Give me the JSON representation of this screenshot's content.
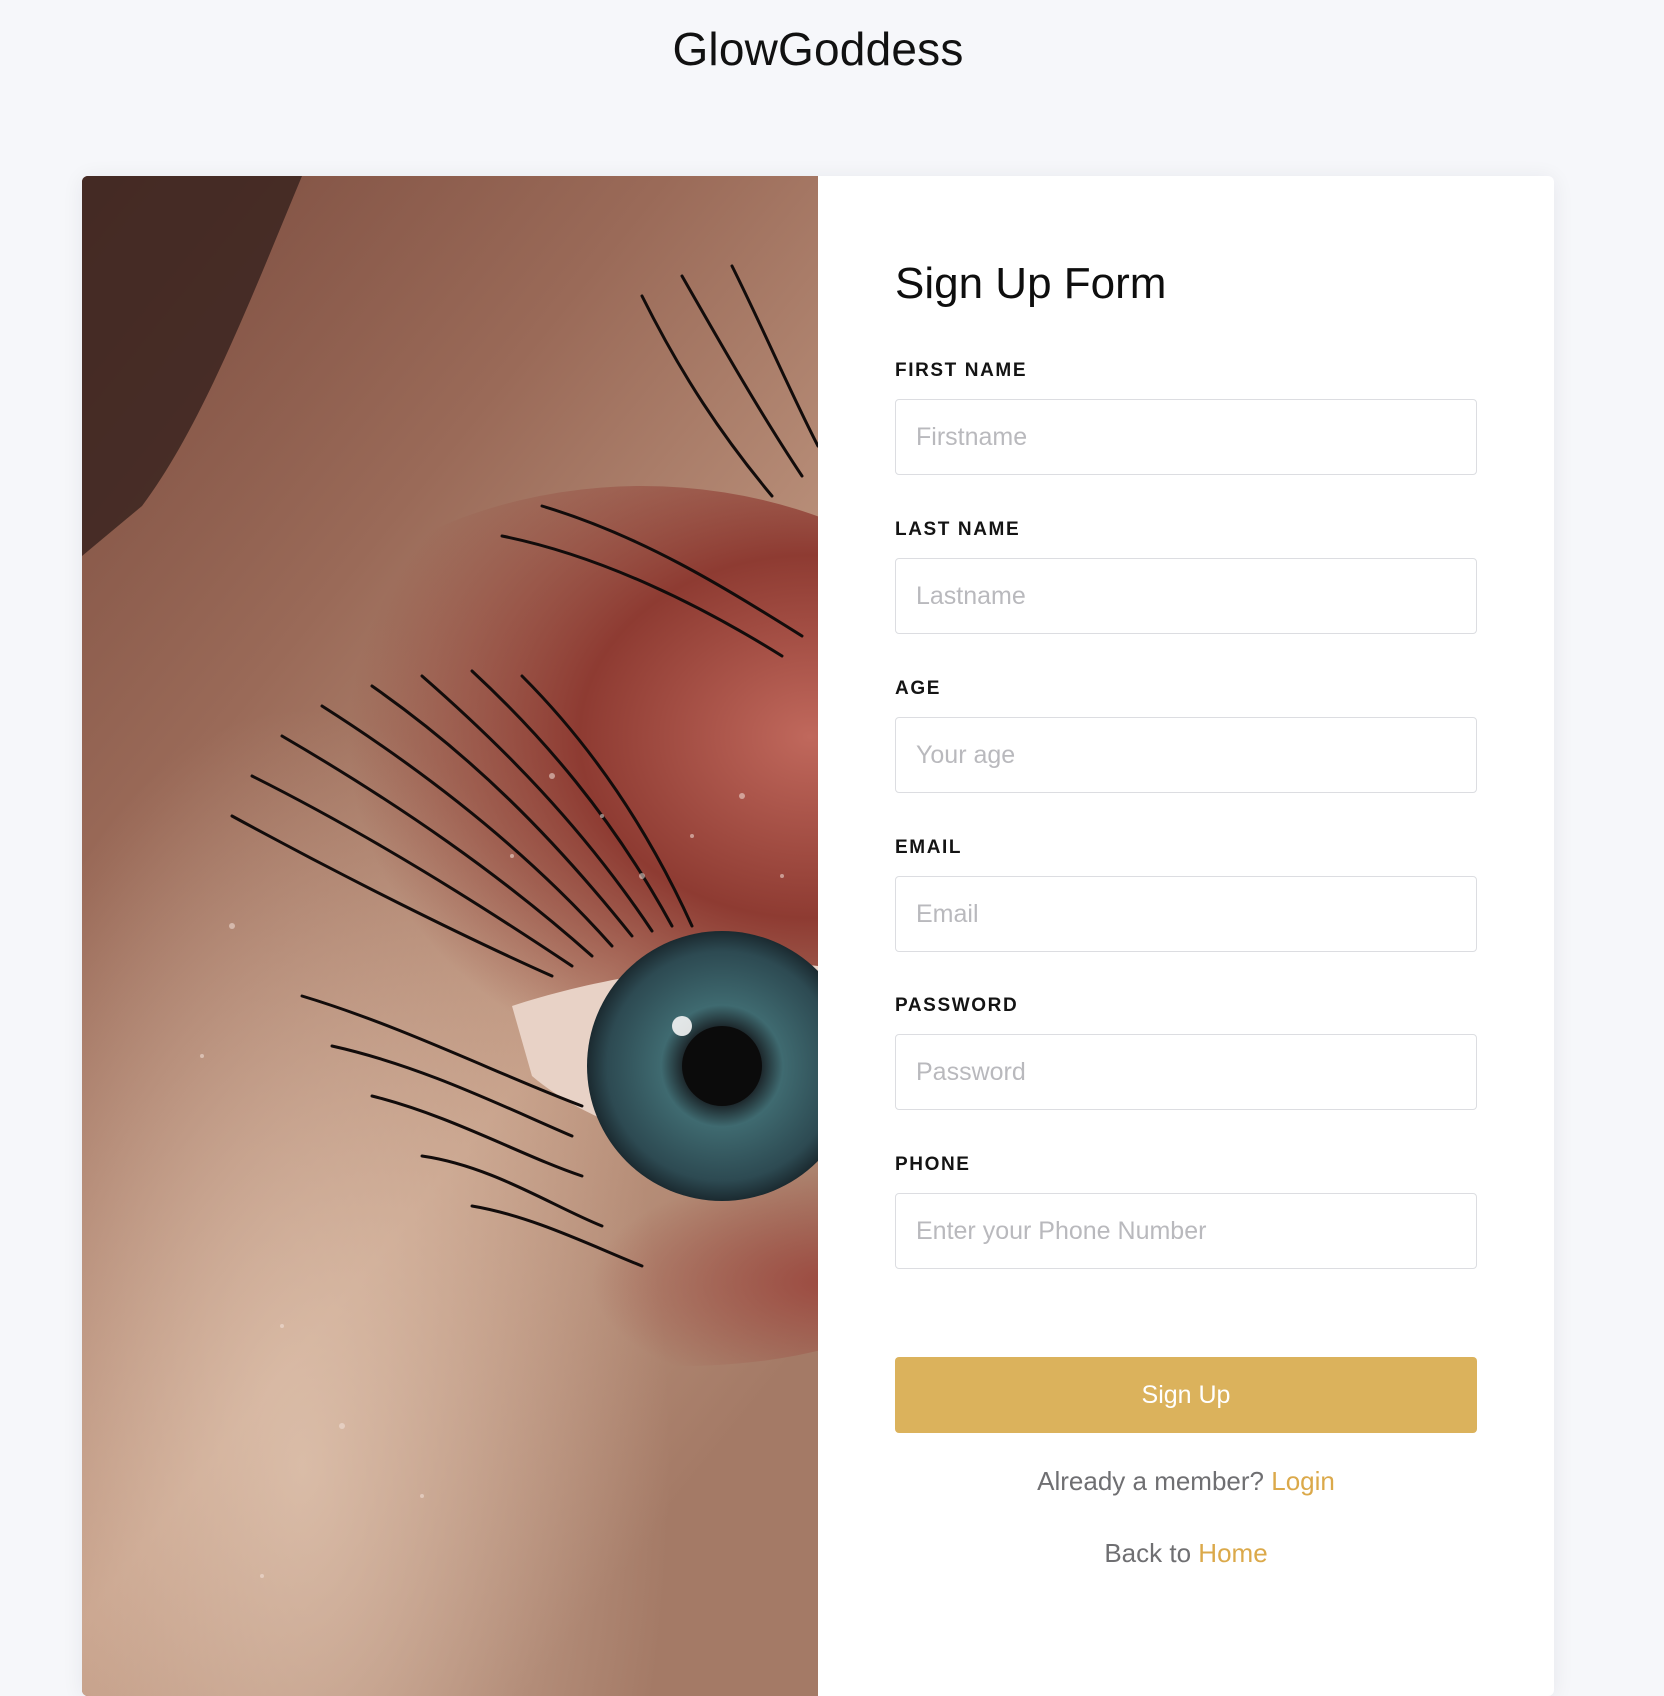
{
  "header": {
    "brand": "GlowGoddess"
  },
  "hero": {
    "image": "eye-makeup-closeup-photo"
  },
  "form": {
    "title": "Sign Up Form",
    "fields": [
      {
        "label": "FIRST NAME",
        "placeholder": "Firstname",
        "type": "text"
      },
      {
        "label": "LAST NAME",
        "placeholder": "Lastname",
        "type": "text"
      },
      {
        "label": "AGE",
        "placeholder": "Your age",
        "type": "text"
      },
      {
        "label": "EMAIL",
        "placeholder": "Email",
        "type": "email"
      },
      {
        "label": "PASSWORD",
        "placeholder": "Password",
        "type": "password"
      },
      {
        "label": "PHONE",
        "placeholder": "Enter your Phone Number",
        "type": "tel"
      }
    ],
    "submit_label": "Sign Up",
    "login_prompt": "Already a member?",
    "login_link": "Login",
    "home_prompt": "Back to",
    "home_link": "Home"
  },
  "colors": {
    "page_background": "#f6f7fa",
    "accent": "#dbb25c",
    "link": "#dba94a"
  }
}
